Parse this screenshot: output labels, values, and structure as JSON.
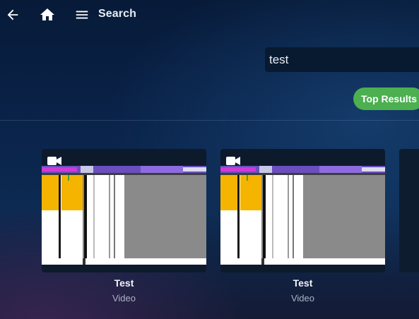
{
  "header": {
    "title": "Search",
    "back_icon": "arrow-left-icon",
    "home_icon": "home-icon",
    "menu_icon": "hamburger-menu-icon"
  },
  "search": {
    "value": "test"
  },
  "filters": {
    "active_chip": "Top Results",
    "chip_color": "#4caf50"
  },
  "results": [
    {
      "title": "Test",
      "type": "Video",
      "badge_icon": "video-camera-icon"
    },
    {
      "title": "Test",
      "type": "Video",
      "badge_icon": "video-camera-icon"
    }
  ],
  "colors": {
    "background": "#0a2248",
    "card": "#0d1a2c",
    "search_box": "#081a30"
  }
}
